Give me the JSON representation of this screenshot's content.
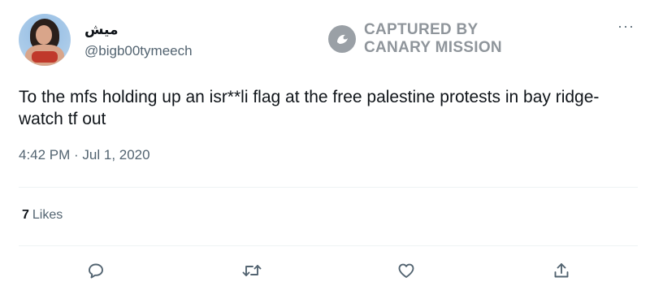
{
  "user": {
    "display_name": "ميش",
    "handle": "@bigb00tymeech"
  },
  "watermark": {
    "line1": "CAPTURED BY",
    "line2": "CANARY MISSION"
  },
  "more_label": "···",
  "tweet": {
    "text": "To the mfs holding up an isr**li flag at the free palestine protests in bay ridge- watch tf out",
    "timestamp": "4:42 PM · Jul 1, 2020"
  },
  "stats": {
    "likes_count": "7",
    "likes_label": "Likes"
  },
  "actions": {
    "reply_icon": "reply-icon",
    "retweet_icon": "retweet-icon",
    "like_icon": "heart-icon",
    "share_icon": "share-icon"
  },
  "colors": {
    "text_primary": "#0f1419",
    "text_secondary": "#536471",
    "watermark": "#8f959b",
    "divider": "#eff3f4"
  }
}
